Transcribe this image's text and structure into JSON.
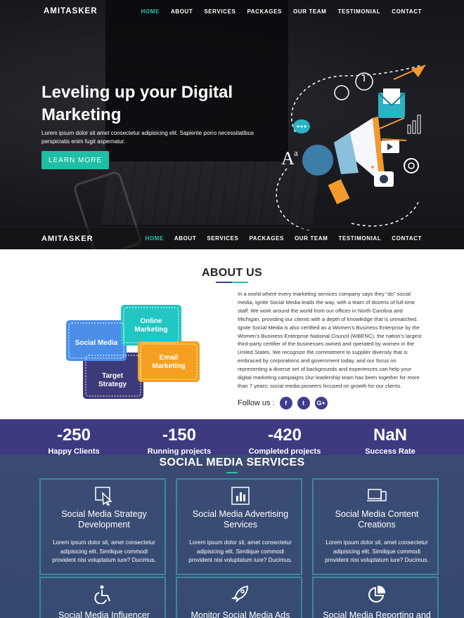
{
  "brand": "AMITASKER",
  "nav": [
    "HOME",
    "ABOUT",
    "SERVICES",
    "PACKAGES",
    "OUR TEAM",
    "TESTIMONIAL",
    "CONTACT"
  ],
  "hero": {
    "title": "Leveling up your Digital Marketing",
    "subtitle": "Lorem ipsum dolor sit amet consectetur adipisicing elit. Sapiente porro necessitatibus perspiciatis enim fugit aspernatur.",
    "button": "LEARN MORE"
  },
  "about": {
    "title": "ABOUT US",
    "puzzle": {
      "social_media": "Social Media",
      "online_marketing": "Online Marketing",
      "email_marketing": "Email Marketing",
      "target_strategy": "Target Strategy"
    },
    "text": "In a world where every marketing services company says they “do” social media, Ignite Social Media leads the way, with a team of dozens of full-time staff. We work around the world from our offices in North Carolina and Michigan, providing our clients with a depth of knowledge that is unmatched. Ignite Social Media is also certified as a Women’s Business Enterprise by the Women’s Business Enterprise National Council (WBENC), the nation’s largest third-party certifier of the businesses owned and operated by women in the United States. We recognize the commitment to supplier diversity that is embraced by corporations and government today, and our focus on representing a diverse set of backgrounds and experiences can help your digital marketing campaigns Our leadership team has been together for more than 7 years; social media pioneers focused on growth for our clients.",
    "follow_label": "Follow us :",
    "social": [
      "f",
      "t",
      "G+"
    ],
    "social_icons": [
      "facebook-icon",
      "twitter-icon",
      "google-plus-icon"
    ]
  },
  "stats": [
    {
      "value": "-250",
      "label": "Happy Clients"
    },
    {
      "value": "-150",
      "label": "Running projects"
    },
    {
      "value": "-420",
      "label": "Completed projects"
    },
    {
      "value": "NaN",
      "label": "Success Rate"
    }
  ],
  "services": {
    "title": "SOCIAL MEDIA SERVICES",
    "items": [
      {
        "title": "Social Media Strategy Development",
        "desc": "Lorem ipsum dolor sit, amet consectetur adipisicing elit. Similique commodi provident nisi voluptatum iure? Ducimus.",
        "icon": "cursor-click-icon"
      },
      {
        "title": "Social Media Advertising Services",
        "desc": "Lorem ipsum dolor sit, amet consectetur adipisicing elit. Similique commodi provident nisi voluptatum iure? Ducimus.",
        "icon": "bar-chart-icon"
      },
      {
        "title": "Social Media Content Creations",
        "desc": "Lorem ipsum dolor sit, amet consectetur adipisicing elit. Similique commodi provident nisi voluptatum iure? Ducimus.",
        "icon": "devices-icon"
      },
      {
        "title": "Social Media Influencer",
        "icon": "accessibility-icon"
      },
      {
        "title": "Monitor Social Media Ads",
        "icon": "rocket-icon"
      },
      {
        "title": "Social Media Reporting and",
        "icon": "pie-chart-icon"
      }
    ]
  },
  "colors": {
    "accent": "#29c3a7",
    "brand_purple": "#3e3a80",
    "services_bg": "#3a4a72"
  }
}
